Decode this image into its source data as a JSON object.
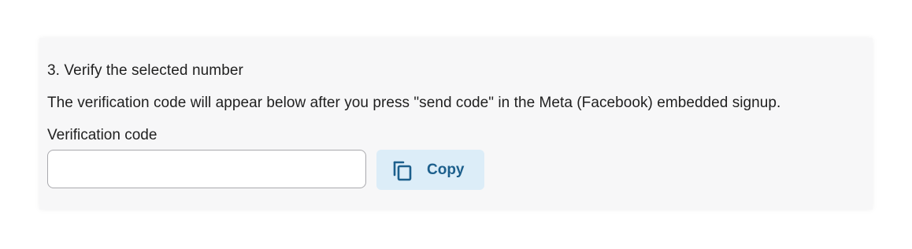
{
  "section": {
    "step_title": "3. Verify the selected number",
    "description": "The verification code will appear below after you press \"send code\" in the Meta (Facebook) embedded signup.",
    "field_label": "Verification code",
    "code_value": "",
    "copy_label": "Copy",
    "copy_icon": "copy-icon"
  },
  "colors": {
    "card_background": "#f7f7f8",
    "button_background": "#dcedf8",
    "button_text": "#1c5f8c"
  }
}
